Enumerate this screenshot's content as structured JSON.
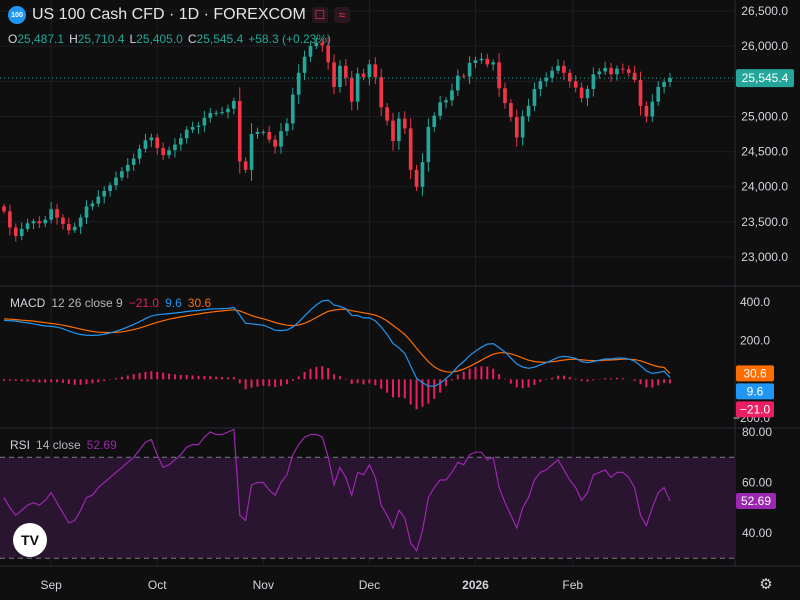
{
  "header": {
    "symbol_badge": "100",
    "title": "US 100 Cash CFD · 1D · FOREXCOM",
    "ohlc": {
      "o_label": "O",
      "o": "25,487.1",
      "h_label": "H",
      "h": "25,710.4",
      "l_label": "L",
      "l": "25,405.0",
      "c_label": "C",
      "c": "25,545.4",
      "change": "+58.3 (+0.23%)"
    }
  },
  "colors": {
    "up": "#26a69a",
    "down": "#f23645",
    "macd_line": "#2196f3",
    "signal_line": "#ff6d00",
    "histogram": "#e91e63",
    "rsi_line": "#9c27b0",
    "rsi_band": "#2a1530",
    "last_price": "#26a69a"
  },
  "macd": {
    "label": "MACD",
    "params": "12 26 close 9",
    "hist": "−21.0",
    "macd": "9.6",
    "signal": "30.6"
  },
  "rsi": {
    "label": "RSI",
    "params": "14 close",
    "value": "52.69"
  },
  "icons": {
    "logo": "tradingview-logo-icon",
    "settings": "gear-icon"
  },
  "chart_data": [
    {
      "type": "candlestick",
      "title": "US 100 Cash CFD · 1D · FOREXCOM",
      "ylim": [
        22600,
        26600
      ],
      "y_ticks": [
        "26,500.0",
        "26,000.0",
        "25,500.0",
        "25,000.0",
        "24,500.0",
        "24,000.0",
        "23,500.0",
        "23,000.0"
      ],
      "y_tick_values": [
        26500,
        26000,
        25500,
        25000,
        24500,
        24000,
        23500,
        23000
      ],
      "last_price": 25545.4,
      "last_price_label": "25,545.4",
      "x_ticks": [
        "Sep",
        "Oct",
        "Nov",
        "Dec",
        "2026",
        "Feb"
      ],
      "x_tick_index": [
        8,
        26,
        44,
        62,
        80,
        96.5
      ],
      "closes": [
        23650,
        23420,
        23300,
        23400,
        23480,
        23510,
        23480,
        23530,
        23680,
        23560,
        23470,
        23380,
        23430,
        23560,
        23720,
        23760,
        23860,
        23940,
        24020,
        24130,
        24220,
        24310,
        24400,
        24540,
        24660,
        24700,
        24550,
        24450,
        24520,
        24600,
        24690,
        24810,
        24850,
        24870,
        24980,
        25050,
        25050,
        25060,
        25110,
        25220,
        24360,
        24240,
        24750,
        24780,
        24780,
        24670,
        24570,
        24790,
        24900,
        25310,
        25620,
        25850,
        26000,
        26050,
        26010,
        25770,
        25420,
        25720,
        25550,
        25210,
        25610,
        25560,
        25740,
        25560,
        25130,
        24940,
        24650,
        24970,
        24830,
        24240,
        24000,
        24350,
        24850,
        25010,
        25200,
        25230,
        25370,
        25580,
        25570,
        25760,
        25800,
        25820,
        25740,
        25770,
        25400,
        25190,
        24990,
        24700,
        25000,
        25150,
        25390,
        25500,
        25550,
        25650,
        25720,
        25620,
        25500,
        25410,
        25260,
        25390,
        25600,
        25640,
        25690,
        25600,
        25680,
        25670,
        25620,
        25520,
        25150,
        25000,
        25210,
        25420,
        25490,
        25545.4
      ]
    },
    {
      "type": "line",
      "title": "MACD 12 26 close 9",
      "ylim": [
        -250,
        450
      ],
      "y_ticks": [
        "400.0",
        "200.0",
        "−200.0"
      ],
      "y_tick_values": [
        400,
        200,
        -200
      ],
      "series": [
        {
          "name": "MACD",
          "values": [
            305,
            304,
            301,
            296,
            292,
            287,
            281,
            276,
            274,
            270,
            262,
            250,
            239,
            232,
            228,
            227,
            229,
            233,
            240,
            249,
            259,
            271,
            284,
            298,
            314,
            327,
            334,
            337,
            340,
            343,
            346,
            351,
            354,
            356,
            360,
            364,
            365,
            366,
            367,
            372,
            333,
            290,
            287,
            283,
            280,
            268,
            254,
            252,
            255,
            270,
            296,
            328,
            358,
            385,
            405,
            410,
            384,
            378,
            365,
            331,
            330,
            318,
            318,
            302,
            271,
            233,
            186,
            163,
            134,
            69,
            5,
            -17,
            -35,
            -36,
            -21,
            4,
            31,
            66,
            92,
            122,
            146,
            166,
            182,
            185,
            164,
            141,
            110,
            80,
            64,
            57,
            63,
            75,
            86,
            99,
            114,
            119,
            115,
            108,
            92,
            86,
            92,
            99,
            105,
            105,
            110,
            110,
            105,
            94,
            71,
            43,
            31,
            35,
            42,
            9.6
          ]
        },
        {
          "name": "Signal",
          "values": [
            313,
            311,
            309,
            306,
            304,
            301,
            297,
            293,
            289,
            285,
            280,
            274,
            267,
            260,
            253,
            248,
            244,
            242,
            242,
            243,
            246,
            251,
            257,
            265,
            275,
            285,
            295,
            303,
            311,
            317,
            323,
            328,
            334,
            338,
            343,
            347,
            351,
            354,
            357,
            360,
            354,
            342,
            330,
            321,
            313,
            304,
            294,
            286,
            280,
            278,
            281,
            290,
            304,
            320,
            337,
            352,
            358,
            362,
            362,
            355,
            350,
            344,
            339,
            332,
            320,
            302,
            279,
            256,
            232,
            199,
            160,
            125,
            91,
            65,
            48,
            39,
            37,
            43,
            53,
            67,
            83,
            99,
            116,
            130,
            137,
            138,
            132,
            122,
            110,
            99,
            92,
            89,
            88,
            91,
            95,
            100,
            103,
            104,
            101,
            98,
            97,
            97,
            99,
            100,
            102,
            104,
            104,
            102,
            96,
            85,
            74,
            66,
            61,
            30.6
          ]
        },
        {
          "name": "Histogram",
          "values": [
            -8,
            -7,
            -8,
            -10,
            -12,
            -14,
            -16,
            -17,
            -15,
            -15,
            -18,
            -24,
            -28,
            -28,
            -25,
            -21,
            -15,
            -9,
            -2,
            6,
            13,
            20,
            27,
            33,
            39,
            42,
            39,
            34,
            29,
            26,
            23,
            23,
            20,
            18,
            17,
            17,
            14,
            12,
            10,
            12,
            -21,
            -52,
            -43,
            -38,
            -33,
            -36,
            -40,
            -34,
            -25,
            -8,
            15,
            38,
            54,
            65,
            68,
            58,
            26,
            16,
            3,
            -24,
            -20,
            -26,
            -21,
            -30,
            -49,
            -69,
            -93,
            -93,
            -98,
            -130,
            -155,
            -142,
            -126,
            -101,
            -69,
            -35,
            -6,
            23,
            39,
            55,
            63,
            67,
            66,
            55,
            27,
            3,
            -22,
            -42,
            -46,
            -42,
            -29,
            -14,
            -2,
            8,
            19,
            19,
            12,
            4,
            -9,
            -12,
            -5,
            2,
            6,
            5,
            8,
            6,
            1,
            -8,
            -25,
            -42,
            -43,
            -31,
            -19,
            -21.0
          ]
        }
      ]
    },
    {
      "type": "line",
      "title": "RSI 14 close",
      "ylim": [
        25,
        82
      ],
      "y_ticks": [
        "80.00",
        "60.00",
        "40.00"
      ],
      "y_tick_values": [
        80,
        60,
        40
      ],
      "band": [
        30,
        70
      ],
      "series": [
        {
          "name": "RSI",
          "values": [
            54,
            50,
            47,
            49,
            51,
            52,
            51,
            53,
            56,
            52,
            48,
            44,
            45,
            49,
            54,
            55,
            58,
            60,
            62,
            64,
            66,
            68,
            70,
            73,
            76,
            77,
            71,
            66,
            67,
            69,
            71,
            74,
            75,
            75,
            78,
            80,
            79,
            79,
            80,
            81,
            47,
            45,
            59,
            60,
            60,
            57,
            55,
            60,
            63,
            71,
            75,
            78,
            79,
            79,
            78,
            70,
            59,
            66,
            62,
            55,
            64,
            63,
            67,
            62,
            51,
            47,
            42,
            49,
            46,
            36,
            33,
            41,
            54,
            58,
            61,
            61,
            64,
            68,
            67,
            71,
            72,
            72,
            69,
            70,
            58,
            52,
            47,
            42,
            50,
            54,
            61,
            64,
            65,
            67,
            69,
            65,
            61,
            58,
            53,
            56,
            63,
            64,
            65,
            62,
            64,
            64,
            62,
            58,
            47,
            43,
            50,
            56,
            58,
            52.69
          ]
        }
      ]
    }
  ]
}
